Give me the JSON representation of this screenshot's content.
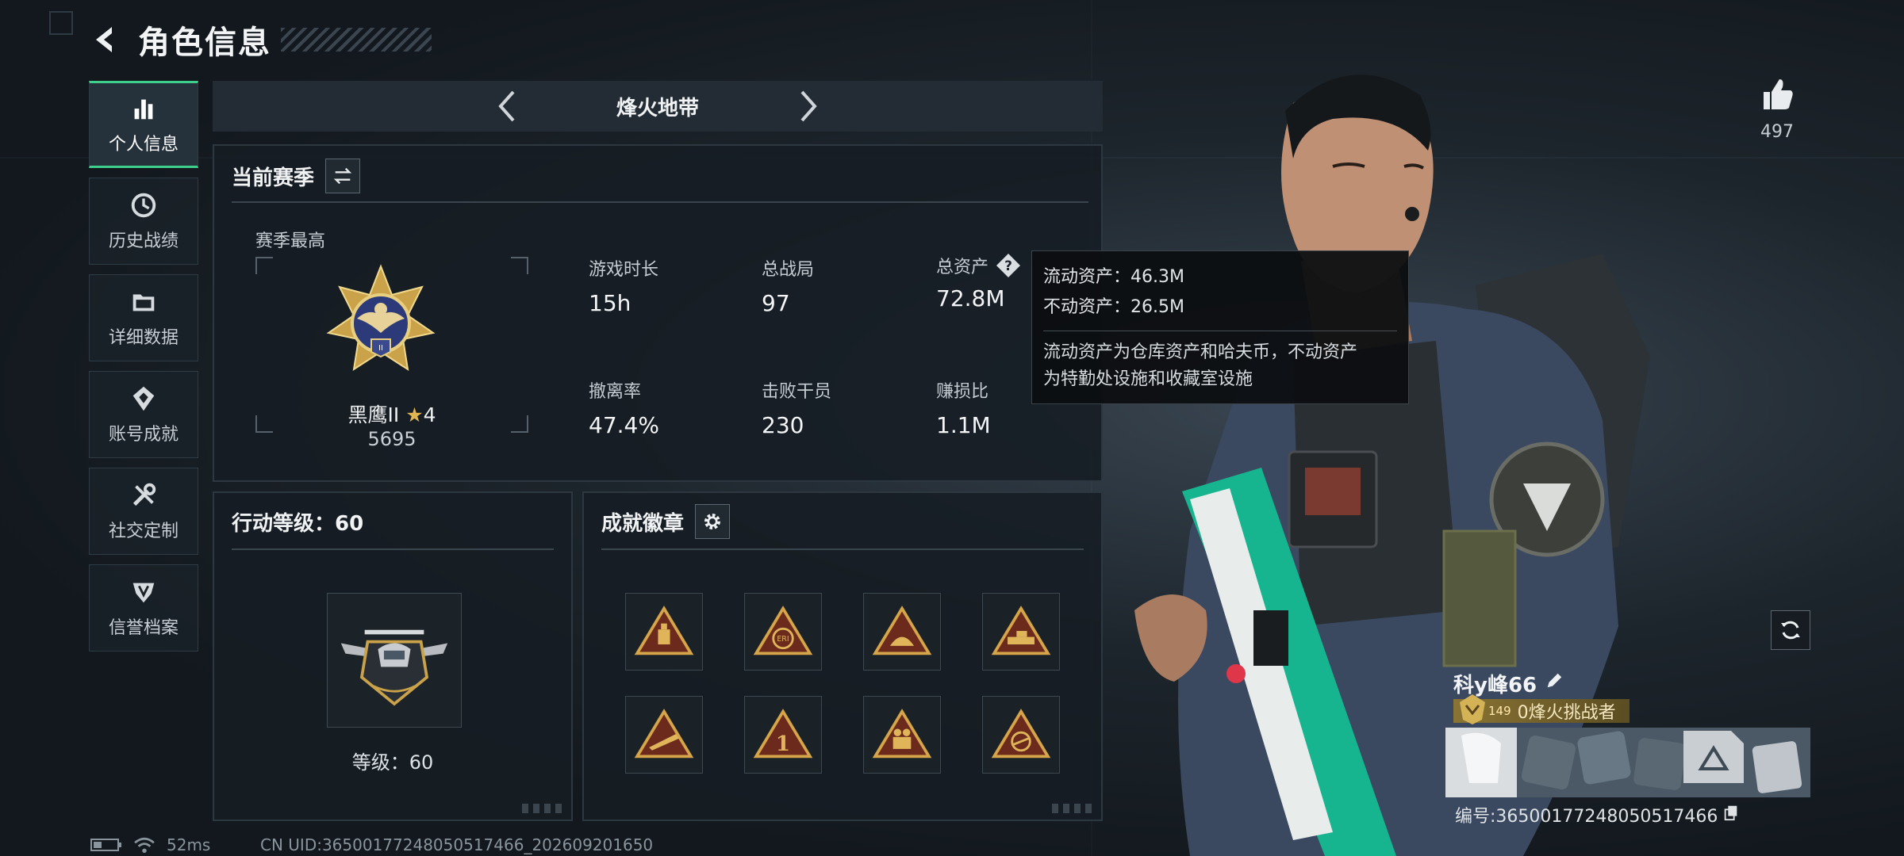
{
  "header": {
    "title": "角色信息"
  },
  "sidebar": {
    "items": [
      {
        "label": "个人信息",
        "icon": "bar-chart-icon",
        "active": true
      },
      {
        "label": "历史战绩",
        "icon": "clock-icon"
      },
      {
        "label": "详细数据",
        "icon": "folder-icon"
      },
      {
        "label": "账号成就",
        "icon": "achievement-icon"
      },
      {
        "label": "社交定制",
        "icon": "tools-icon"
      },
      {
        "label": "信誉档案",
        "icon": "shield-icon"
      }
    ]
  },
  "mode": {
    "name": "烽火地带"
  },
  "season": {
    "title": "当前赛季",
    "rank_caption": "赛季最高",
    "rank_name": "黑鹰II",
    "rank_stars": "4",
    "rank_score": "5695",
    "stats": [
      {
        "label": "游戏时长",
        "value": "15h"
      },
      {
        "label": "总战局",
        "value": "97"
      },
      {
        "label": "总资产",
        "value": "72.8M"
      },
      {
        "label": "撤离率",
        "value": "47.4%"
      },
      {
        "label": "击败干员",
        "value": "230"
      },
      {
        "label": "赚损比",
        "value": "1.1M"
      }
    ]
  },
  "tooltip": {
    "line1": "流动资产：46.3M",
    "line2": "不动资产：26.5M",
    "desc_line1": "流动资产为仓库资产和哈夫币，不动资产",
    "desc_line2": "为特勤处设施和收藏室设施"
  },
  "action": {
    "title": "行动等级：60",
    "level_text": "等级：60"
  },
  "achievements": {
    "title": "成就徽章",
    "medals": [
      "medal-1",
      "medal-2",
      "medal-3",
      "medal-4",
      "medal-5",
      "medal-6",
      "medal-7",
      "medal-8"
    ]
  },
  "profile": {
    "likes": "497",
    "name": "科y峰66",
    "title_level": "149",
    "title_text": "0烽火挑战者",
    "id_text": "编号:36500177248050517466"
  },
  "status": {
    "ping": "52ms",
    "uid": "CN UID:36500177248050517466_202609201650"
  },
  "colors": {
    "accent": "#3fcf8c",
    "gold": "#c9a24a",
    "teal": "#1fc39a"
  }
}
